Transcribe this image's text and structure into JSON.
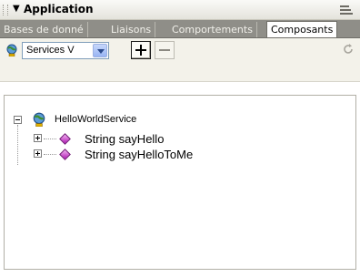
{
  "panel": {
    "title": "Application"
  },
  "tabs": [
    {
      "label": "Bases de donné",
      "active": false
    },
    {
      "label": "Liaisons",
      "active": false
    },
    {
      "label": "Comportements",
      "active": false
    },
    {
      "label": "Composants",
      "active": true
    }
  ],
  "toolbar": {
    "service_select_value": "Services V",
    "add_label": "+",
    "remove_label": "−"
  },
  "tree": {
    "root": {
      "label": "HelloWorldService",
      "icon": "web-service-globe-icon",
      "expanded": true
    },
    "children": [
      {
        "label": "String sayHello",
        "icon": "method-diamond-icon",
        "expanded": false
      },
      {
        "label": "String sayHelloToMe",
        "icon": "method-diamond-icon",
        "expanded": false
      }
    ]
  },
  "colors": {
    "tabbar_bg": "#8f8e88",
    "toolbar_bg": "#f3f2ea",
    "method_icon": "#c028c8",
    "select_border": "#7f9db9"
  }
}
